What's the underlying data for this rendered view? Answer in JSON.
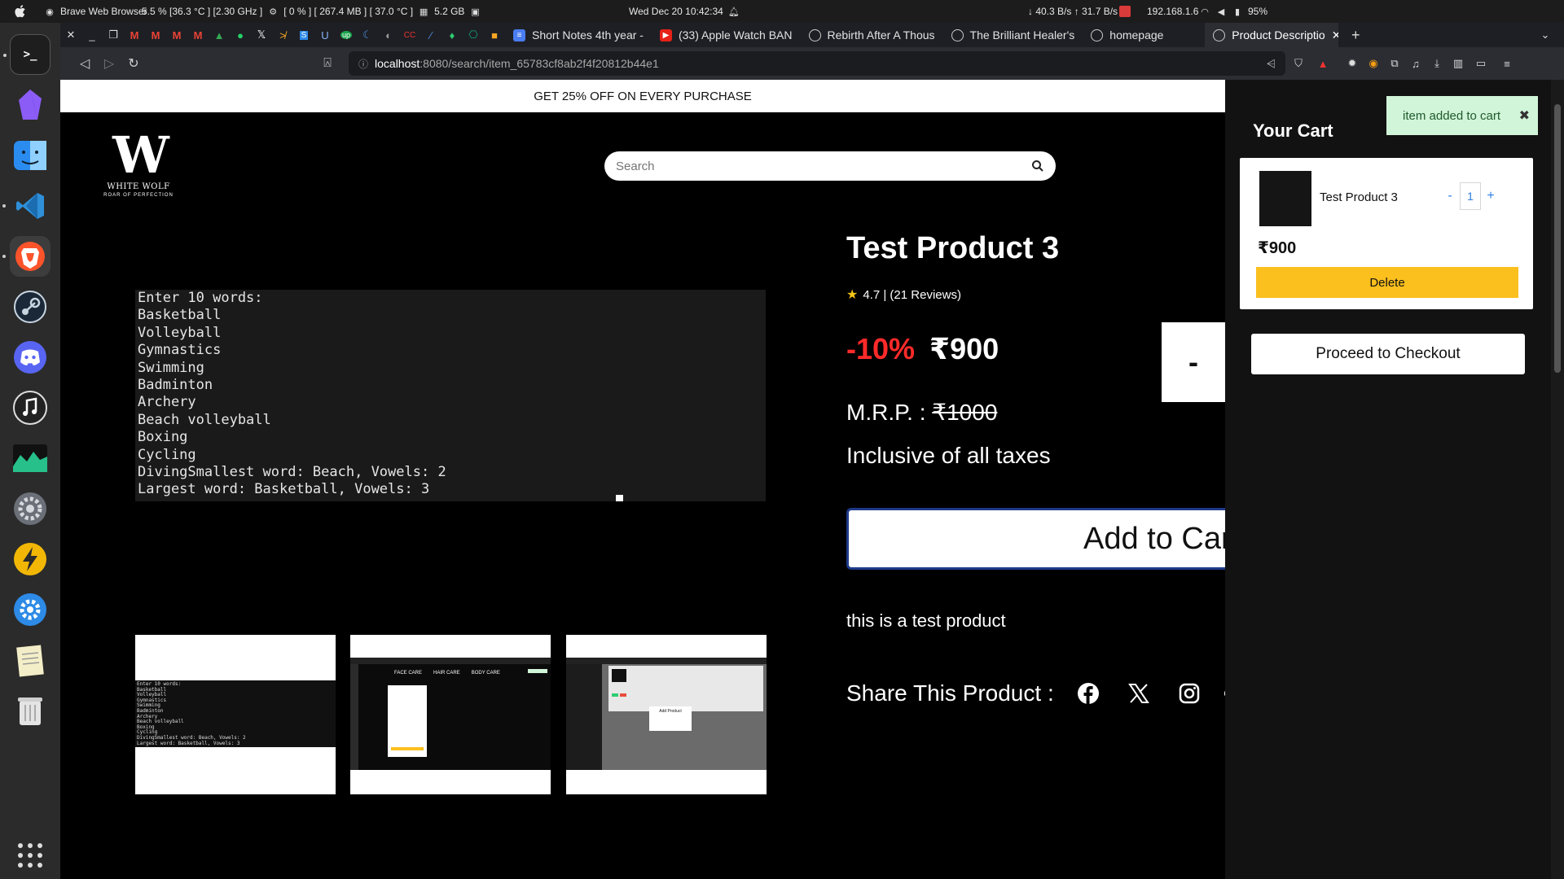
{
  "os_panel": {
    "app_name": "Brave Web Browser",
    "cpu_stats": "5.5 % [36.3 °C ] [2.30 GHz ]",
    "gpu_stats": "[ 0 % ] [ 267.4 MB ] [ 37.0 °C ]",
    "memory": "5.2 GB",
    "datetime": "Wed Dec 20  10:42:34",
    "network_speed": "↓ 40.3 B/s ↑ 31.7 B/s",
    "ip": "192.168.1.6",
    "battery": "95%"
  },
  "tabs": {
    "items": [
      {
        "label": "Short Notes 4th year -",
        "favicon": "docs-icon",
        "color": "#4a7cf2"
      },
      {
        "label": "(33) Apple Watch BAN",
        "favicon": "youtube-icon",
        "color": "#e62117"
      },
      {
        "label": "Rebirth After A Thous",
        "favicon": "globe-icon",
        "color": "#777777"
      },
      {
        "label": "The Brilliant Healer's",
        "favicon": "globe-icon",
        "color": "#777777"
      },
      {
        "label": "homepage",
        "favicon": "globe-icon",
        "color": "#777777"
      },
      {
        "label": "Product Descriptio",
        "favicon": "globe-icon",
        "color": "#777777",
        "active": true
      }
    ],
    "new_tab": "+"
  },
  "address_bar": {
    "host": "localhost",
    "path": ":8080/search/item_65783cf8ab2f4f20812b44e1"
  },
  "page": {
    "promo": "GET 25% OFF ON EVERY PURCHASE",
    "logo": {
      "mark": "W",
      "name": "WHITE WOLF",
      "tagline": "ROAR OF PERFECTION"
    },
    "search": {
      "placeholder": "Search"
    },
    "main_image_text": "Enter 10 words:\nBasketball\nVolleyball\nGymnastics\nSwimming\nBadminton\nArchery\nBeach volleyball\nBoxing\nCycling\nDivingSmallest word: Beach, Vowels: 2\nLargest word: Basketball, Vowels: 3",
    "thumb1_text": "Enter 10 words:\nBasketball\nVolleyball\nGymnastics\nSwimming\nBadminton\nArchery\nBeach volleyball\nBoxing\nCycling\nDivingSmallest word: Beach, Vowels: 2\nLargest word: Basketball, Vowels: 3",
    "thumb2_menu": [
      "FACE CARE",
      "HAIR CARE",
      "BODY CARE"
    ],
    "thumb3_dialog_title": "Add Product",
    "product": {
      "title": "Test Product 3",
      "rating": "4.7 | (21 Reviews)",
      "discount": "-10%",
      "price": "₹900",
      "mrp_label": "M.R.P. : ",
      "mrp_value": "₹1000",
      "taxes": "Inclusive of all taxes",
      "add_to_cart": "Add to Cart",
      "description": "this is a test product",
      "share_label": "Share This Product :",
      "qty_minus": "-"
    }
  },
  "cart": {
    "title": "Your Cart",
    "toast": "item added to cart",
    "item": {
      "name": "Test Product 3",
      "qty": "1",
      "price": "₹900",
      "minus": "-",
      "plus": "+"
    },
    "delete_label": "Delete",
    "checkout_label": "Proceed to Checkout"
  },
  "colors": {
    "discount": "#ff2a2a",
    "delete": "#fbbf1e",
    "toast_bg": "#d1f5d8",
    "accent_blue": "#2f7de1"
  }
}
